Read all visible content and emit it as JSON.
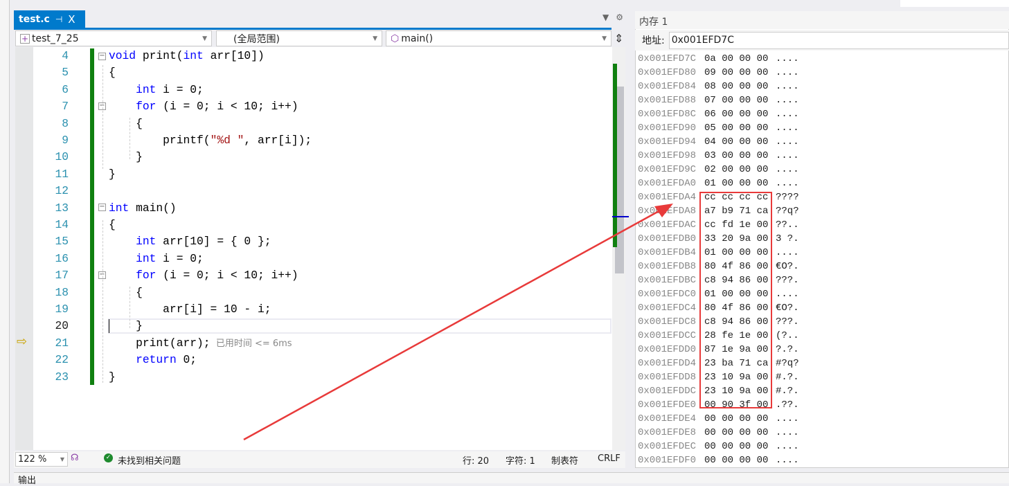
{
  "editor": {
    "tab": {
      "title": "test.c",
      "pin": "⊣",
      "close": "X"
    },
    "project_dropdown": "test_7_25",
    "scope_dropdown": "(全局范围)",
    "member_dropdown": "main()",
    "lines": [
      {
        "n": "4",
        "t": [
          [
            "void",
            "kw"
          ],
          [
            " print(",
            "pl"
          ],
          [
            "int",
            "kw"
          ],
          [
            " arr[10])",
            "pl"
          ]
        ]
      },
      {
        "n": "5",
        "t": [
          [
            "{",
            "pl"
          ]
        ]
      },
      {
        "n": "6",
        "t": [
          [
            "    ",
            "pl"
          ],
          [
            "int",
            "kw"
          ],
          [
            " i = 0;",
            "pl"
          ]
        ]
      },
      {
        "n": "7",
        "t": [
          [
            "    ",
            "pl"
          ],
          [
            "for",
            "kw"
          ],
          [
            " (i = 0; i < 10; i++)",
            "pl"
          ]
        ]
      },
      {
        "n": "8",
        "t": [
          [
            "    {",
            "pl"
          ]
        ]
      },
      {
        "n": "9",
        "t": [
          [
            "        printf(",
            "pl"
          ],
          [
            "\"%d \"",
            "str"
          ],
          [
            ", arr[i]);",
            "pl"
          ]
        ]
      },
      {
        "n": "10",
        "t": [
          [
            "    }",
            "pl"
          ]
        ]
      },
      {
        "n": "11",
        "t": [
          [
            "}",
            "pl"
          ]
        ]
      },
      {
        "n": "12",
        "t": []
      },
      {
        "n": "13",
        "t": [
          [
            "int",
            "kw"
          ],
          [
            " main()",
            "pl"
          ]
        ]
      },
      {
        "n": "14",
        "t": [
          [
            "{",
            "pl"
          ]
        ]
      },
      {
        "n": "15",
        "t": [
          [
            "    ",
            "pl"
          ],
          [
            "int",
            "kw"
          ],
          [
            " arr[10] = { 0 };",
            "pl"
          ]
        ]
      },
      {
        "n": "16",
        "t": [
          [
            "    ",
            "pl"
          ],
          [
            "int",
            "kw"
          ],
          [
            " i = 0;",
            "pl"
          ]
        ]
      },
      {
        "n": "17",
        "t": [
          [
            "    ",
            "pl"
          ],
          [
            "for",
            "kw"
          ],
          [
            " (i = 0; i < 10; i++)",
            "pl"
          ]
        ]
      },
      {
        "n": "18",
        "t": [
          [
            "    {",
            "pl"
          ]
        ]
      },
      {
        "n": "19",
        "t": [
          [
            "        arr[i] = 10 - i;",
            "pl"
          ]
        ]
      },
      {
        "n": "20",
        "t": [
          [
            "    }",
            "pl"
          ]
        ]
      },
      {
        "n": "21",
        "t": [
          [
            "    print(arr);",
            "pl"
          ],
          [
            "  已用时间 <= 6ms",
            "hint"
          ]
        ]
      },
      {
        "n": "22",
        "t": [
          [
            "    ",
            "pl"
          ],
          [
            "return",
            "kw"
          ],
          [
            " 0;",
            "pl"
          ]
        ]
      },
      {
        "n": "23",
        "t": [
          [
            "}",
            "pl"
          ]
        ]
      }
    ],
    "current_line": "20",
    "execution_line": "21"
  },
  "status": {
    "zoom": "122 %",
    "issues": "未找到相关问题",
    "line": "行: 20",
    "char": "字符: 1",
    "tabs": "制表符",
    "eol": "CRLF"
  },
  "output_panel": {
    "title": "输出"
  },
  "memory": {
    "title": "内存 1",
    "address_label": "地址:",
    "address": "0x001EFD7C",
    "rows": [
      [
        "0x001EFD7C",
        "0a 00 00 00",
        "...."
      ],
      [
        "0x001EFD80",
        "09 00 00 00",
        "...."
      ],
      [
        "0x001EFD84",
        "08 00 00 00",
        "...."
      ],
      [
        "0x001EFD88",
        "07 00 00 00",
        "...."
      ],
      [
        "0x001EFD8C",
        "06 00 00 00",
        "...."
      ],
      [
        "0x001EFD90",
        "05 00 00 00",
        "...."
      ],
      [
        "0x001EFD94",
        "04 00 00 00",
        "...."
      ],
      [
        "0x001EFD98",
        "03 00 00 00",
        "...."
      ],
      [
        "0x001EFD9C",
        "02 00 00 00",
        "...."
      ],
      [
        "0x001EFDA0",
        "01 00 00 00",
        "...."
      ],
      [
        "0x001EFDA4",
        "cc cc cc cc",
        "????"
      ],
      [
        "0x001EFDA8",
        "a7 b9 71 ca",
        "??q?"
      ],
      [
        "0x001EFDAC",
        "cc fd 1e 00",
        "??.."
      ],
      [
        "0x001EFDB0",
        "33 20 9a 00",
        "3 ?."
      ],
      [
        "0x001EFDB4",
        "01 00 00 00",
        "...."
      ],
      [
        "0x001EFDB8",
        "80 4f 86 00",
        "€O?."
      ],
      [
        "0x001EFDBC",
        "c8 94 86 00",
        "???."
      ],
      [
        "0x001EFDC0",
        "01 00 00 00",
        "...."
      ],
      [
        "0x001EFDC4",
        "80 4f 86 00",
        "€O?."
      ],
      [
        "0x001EFDC8",
        "c8 94 86 00",
        "???."
      ],
      [
        "0x001EFDCC",
        "28 fe 1e 00",
        "(?.."
      ],
      [
        "0x001EFDD0",
        "87 1e 9a 00",
        "?.?."
      ],
      [
        "0x001EFDD4",
        "23 ba 71 ca",
        "#?q?"
      ],
      [
        "0x001EFDD8",
        "23 10 9a 00",
        "#.?."
      ],
      [
        "0x001EFDDC",
        "23 10 9a 00",
        "#.?."
      ],
      [
        "0x001EFDE0",
        "00 90 3f 00",
        ".??."
      ],
      [
        "0x001EFDE4",
        "00 00 00 00",
        "...."
      ],
      [
        "0x001EFDE8",
        "00 00 00 00",
        "...."
      ],
      [
        "0x001EFDEC",
        "00 00 00 00",
        "...."
      ],
      [
        "0x001EFDF0",
        "00 00 00 00",
        "...."
      ]
    ]
  },
  "annotation_color": "#e83a3a"
}
